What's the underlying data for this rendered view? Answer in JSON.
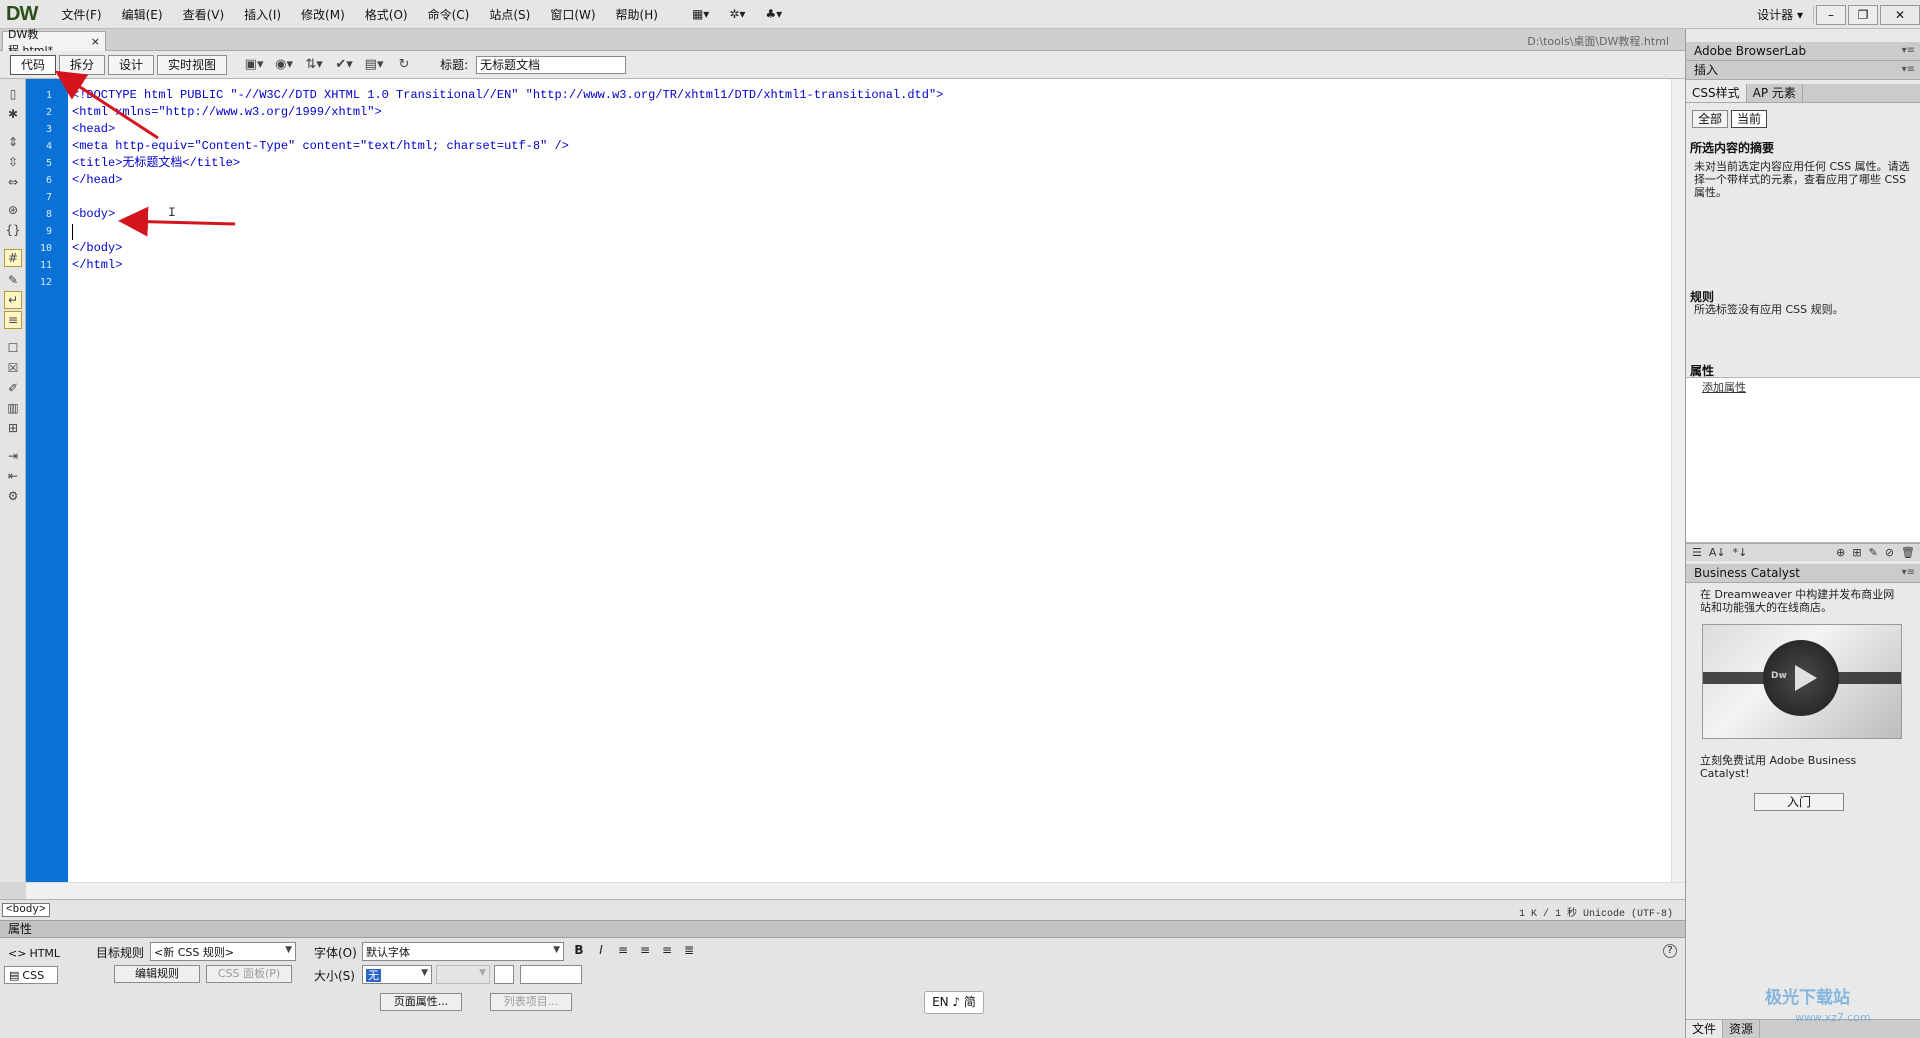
{
  "app": {
    "logo": "DW",
    "menu": [
      "文件(F)",
      "编辑(E)",
      "查看(V)",
      "插入(I)",
      "修改(M)",
      "格式(O)",
      "命令(C)",
      "站点(S)",
      "窗口(W)",
      "帮助(H)"
    ],
    "workspace": "设计器",
    "window_buttons": [
      "–",
      "❐",
      "✕"
    ]
  },
  "document": {
    "tab_label": "DW教程.html*",
    "tab_close": "×",
    "path": "D:\\tools\\桌面\\DW教程.html"
  },
  "toolbar": {
    "views": [
      "代码",
      "拆分",
      "设计",
      "实时视图"
    ],
    "title_label": "标题:",
    "title_value": "无标题文档"
  },
  "code": {
    "line_numbers": [
      "1",
      "2",
      "3",
      "4",
      "5",
      "6",
      "7",
      "8",
      "9",
      "10",
      "11",
      "12"
    ],
    "lines": [
      "<!DOCTYPE html PUBLIC \"-//W3C//DTD XHTML 1.0 Transitional//EN\" \"http://www.w3.org/TR/xhtml1/DTD/xhtml1-transitional.dtd\">",
      "<html xmlns=\"http://www.w3.org/1999/xhtml\">",
      "<head>",
      "<meta http-equiv=\"Content-Type\" content=\"text/html; charset=utf-8\" />",
      "<title>无标题文档</title>",
      "</head>",
      "",
      "<body>",
      "",
      "</body>",
      "</html>",
      ""
    ]
  },
  "status": {
    "tag": "<body>",
    "info": "1 K / 1 秒  Unicode (UTF-8)"
  },
  "properties": {
    "panel_title": "属性",
    "html_label": "HTML",
    "css_label": "CSS",
    "target_rule_label": "目标规则",
    "target_rule_value": "<新 CSS 规则>",
    "edit_rule": "编辑规则",
    "css_panel": "CSS 面板(P)",
    "font_label": "字体(O)",
    "font_value": "默认字体",
    "size_label": "大小(S)",
    "size_value": "无",
    "page_props": "页面属性...",
    "list_item": "列表项目...",
    "format_icons": [
      "B",
      "I"
    ]
  },
  "ime": "EN ♪ 简",
  "right_panel": {
    "browserlab": "Adobe BrowserLab",
    "insert": "插入",
    "css_tabs": [
      "CSS样式",
      "AP 元素"
    ],
    "mode_buttons": [
      "全部",
      "当前"
    ],
    "summary_heading": "所选内容的摘要",
    "summary_text": "未对当前选定内容应用任何 CSS 属性。请选择一个带样式的元素，查看应用了哪些 CSS 属性。",
    "rules_heading": "规则",
    "rules_text": "所选标签没有应用 CSS 规则。",
    "attributes_heading": "属性",
    "add_attribute": "添加属性",
    "bc_title": "Business Catalyst",
    "bc_text": "在 Dreamweaver 中构建并发布商业网站和功能强大的在线商店。",
    "bc_thumb_label": "Dw",
    "bc_cta": "立刻免费试用 Adobe Business Catalyst!",
    "bc_button": "入门",
    "bottom_tabs": [
      "文件",
      "资源"
    ]
  },
  "watermark": {
    "main": "极光下载站",
    "sub": "www.xz7.com"
  }
}
